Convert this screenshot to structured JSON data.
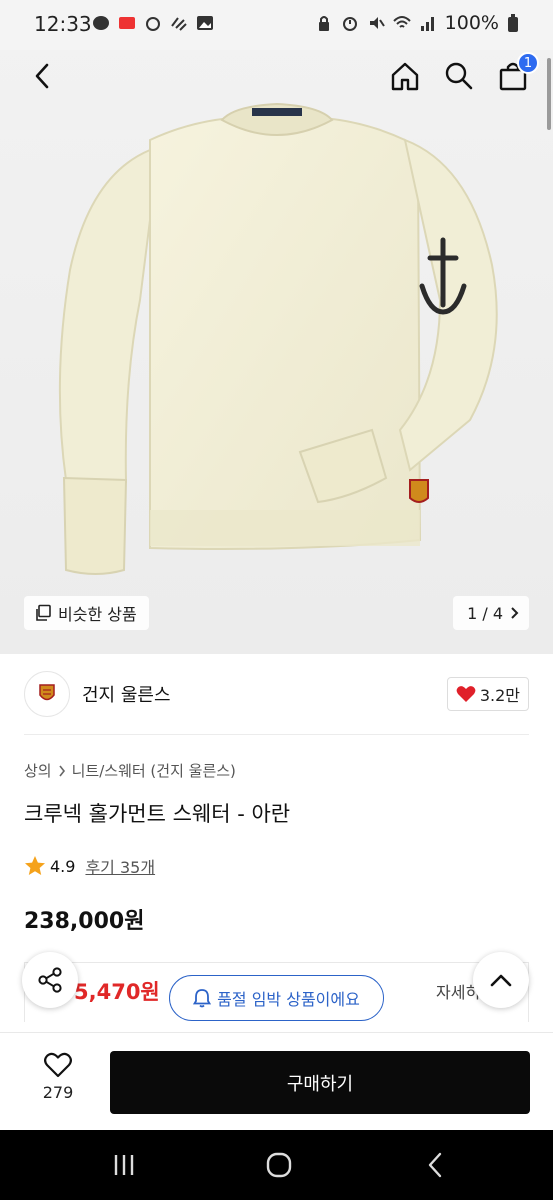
{
  "status_bar": {
    "time": "12:33",
    "battery": "100%"
  },
  "header": {
    "cart_count": "1"
  },
  "gallery": {
    "similar_label": "비슷한 상품",
    "page_counter": "1 / 4"
  },
  "seller": {
    "name": "건지 울른스",
    "likes": "3.2만"
  },
  "product": {
    "breadcrumb_root": "상의",
    "breadcrumb_child": "니트/스웨터 (건지 울른스)",
    "title": "크루넥 홀가먼트 스웨터 - 아란",
    "rating": "4.9",
    "reviews": "후기 35개",
    "price": "238,000원",
    "sale_price": "5,470원",
    "detail_label": "자세히"
  },
  "toast": {
    "label": "품절 임박 상품이에요"
  },
  "action_bar": {
    "wish_count": "279",
    "buy_label": "구매하기"
  },
  "colors": {
    "accent_blue": "#2c63c8",
    "badge_blue": "#2e6bf0",
    "sale_red": "#e02828",
    "heart_red": "#e0202a",
    "star_orange": "#f5a21b",
    "buy_black": "#0a0a0a"
  }
}
